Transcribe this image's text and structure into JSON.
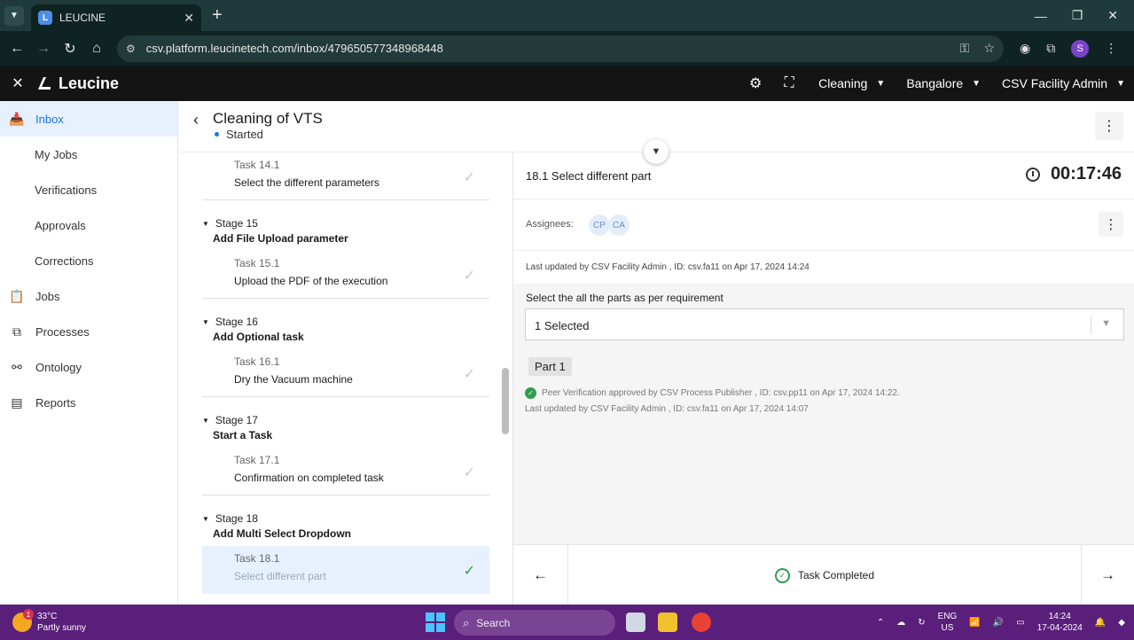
{
  "browser": {
    "tab_title": "LEUCINE",
    "tab_favicon": "L",
    "url": "csv.platform.leucinetech.com/inbox/479650577348968448",
    "profile_initial": "S"
  },
  "app": {
    "brand": "Leucine",
    "header": {
      "use_case": "Cleaning",
      "facility": "Bangalore",
      "role": "CSV Facility Admin"
    }
  },
  "sidebar": {
    "items": [
      {
        "label": "Inbox",
        "icon": "inbox-icon"
      },
      {
        "label": "My Jobs"
      },
      {
        "label": "Verifications"
      },
      {
        "label": "Approvals"
      },
      {
        "label": "Corrections"
      },
      {
        "label": "Jobs",
        "icon": "clipboard-icon"
      },
      {
        "label": "Processes",
        "icon": "process-icon"
      },
      {
        "label": "Ontology",
        "icon": "hierarchy-icon"
      },
      {
        "label": "Reports",
        "icon": "report-icon"
      }
    ]
  },
  "job": {
    "title": "Cleaning of VTS",
    "status": "Started"
  },
  "tasklist": {
    "top_task": {
      "num": "Task 14.1",
      "name": "Select the different parameters"
    },
    "stages": [
      {
        "num": "Stage 15",
        "name": "Add File Upload parameter",
        "task_num": "Task 15.1",
        "task_name": "Upload the PDF of the execution"
      },
      {
        "num": "Stage 16",
        "name": "Add Optional task",
        "task_num": "Task 16.1",
        "task_name": "Dry the Vacuum machine"
      },
      {
        "num": "Stage 17",
        "name": "Start a Task",
        "task_num": "Task 17.1",
        "task_name": "Confirmation on completed task"
      },
      {
        "num": "Stage 18",
        "name": "Add Multi Select Dropdown",
        "task_num": "Task 18.1",
        "task_name": "Select different part"
      }
    ]
  },
  "detail": {
    "title": "18.1 Select different part",
    "timer": "00:17:46",
    "assignees_label": "Assignees:",
    "assignees": [
      "CP",
      "CA"
    ],
    "last_updated": "Last updated by CSV Facility Admin , ID: csv.fa11 on Apr 17, 2024 14:24",
    "param_label": "Select the all the parts as per requirement",
    "select_value": "1 Selected",
    "chip": "Part 1",
    "verification": "Peer Verification approved by CSV Process Publisher , ID: csv.pp11 on Apr 17, 2024 14:22.",
    "param_updated": "Last updated by CSV Facility Admin , ID: csv.fa11 on Apr 17, 2024 14:07"
  },
  "footer": {
    "status": "Task Completed"
  },
  "taskbar": {
    "temp": "33°C",
    "weather": "Partly sunny",
    "weather_badge": "1",
    "search": "Search",
    "lang_top": "ENG",
    "lang_bottom": "US",
    "time": "14:24",
    "date": "17-04-2024"
  },
  "colors": {
    "accent": "#1a73e8",
    "success": "#2e9e4a",
    "header_bg": "#141414",
    "taskbar_bg": "#5a1f7a"
  }
}
